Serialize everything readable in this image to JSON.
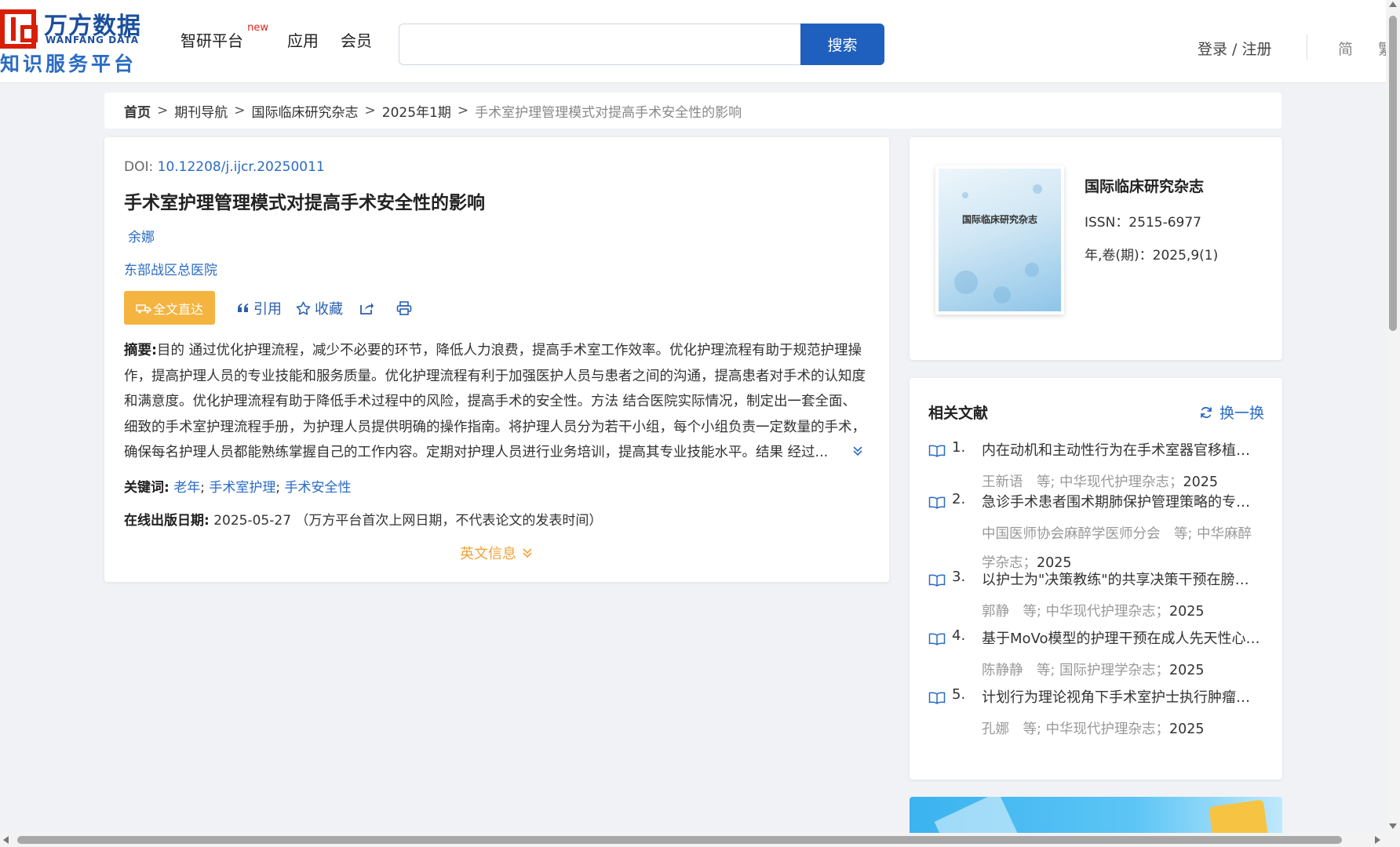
{
  "header": {
    "logo_cn": "万方数据",
    "logo_en": "WANFANG DATA",
    "logo_sub": "知识服务平台",
    "nav": [
      {
        "label": "智研平台",
        "badge": "new"
      },
      {
        "label": "应用"
      },
      {
        "label": "会员"
      }
    ],
    "search_value": "",
    "search_button": "搜索",
    "login": "登录 / 注册",
    "lang_simplified": "简",
    "lang_traditional": "繁"
  },
  "breadcrumb": {
    "items": [
      "首页",
      "期刊导航",
      "国际临床研究杂志",
      "2025年1期"
    ],
    "current": "手术室护理管理模式对提高手术安全性的影响",
    "separator": ">"
  },
  "article": {
    "doi_label": "DOI:",
    "doi_value": "10.12208/j.ijcr.20250011",
    "title": "手术室护理管理模式对提高手术安全性的影响",
    "author": "余娜",
    "organization": "东部战区总医院",
    "actions": {
      "fulltext": "全文直达",
      "cite": "引用",
      "favorite": "收藏"
    },
    "abstract_label": "摘要:",
    "abstract_text": "目的 通过优化护理流程，减少不必要的环节，降低人力浪费，提高手术室工作效率。优化护理流程有助于规范护理操作，提高护理人员的专业技能和服务质量。优化护理流程有利于加强医护人员与患者之间的沟通，提高患者对手术的认知度和满意度。优化护理流程有助于降低手术过程中的风险，提高手术的安全性。方法 结合医院实际情况，制定出一套全面、细致的手术室护理流程手册，为护理人员提供明确的操作指南。将护理人员分为若干小组，每个小组负责一定数量的手术，确保每名护理人员都能熟练掌握自己的工作内容。定期对护理人员进行业务培训，提高其专业技能水平。结果 经过...",
    "keywords_label": "关键词:",
    "keywords": [
      "老年",
      "手术室护理",
      "手术安全性"
    ],
    "pubdate_label": "在线出版日期:",
    "pubdate_value": "2025-05-27",
    "pubdate_note": "（万方平台首次上网日期，不代表论文的发表时间）",
    "english_info": "英文信息"
  },
  "journal": {
    "cover_title": "国际临床研究杂志",
    "name": "国际临床研究杂志",
    "issn": "ISSN：2515-6977",
    "volume": "年,卷(期)：2025,9(1)"
  },
  "related": {
    "title": "相关文献",
    "refresh": "换一换",
    "items": [
      {
        "num": "1.",
        "title": "内在动机和主动性行为在手术室器官移植护理中的作用研究",
        "meta": "王新语　等;  中华现代护理杂志；",
        "year": "2025"
      },
      {
        "num": "2.",
        "title": "急诊手术患者围术期肺保护管理策略的专家共识",
        "meta": "中国医师协会麻醉学医师分会　等;  中华麻醉学杂志；",
        "year": "2025"
      },
      {
        "num": "3.",
        "title": "以护士为\"决策教练\"的共享决策干预在膀胱癌患者中的应用",
        "meta": "郭静　等;  中华现代护理杂志；",
        "year": "2025"
      },
      {
        "num": "4.",
        "title": "基于MoVo模型的护理干预在成人先天性心脏病患者中的应用",
        "meta": "陈静静　等;  国际护理学杂志；",
        "year": "2025"
      },
      {
        "num": "5.",
        "title": "计划行为理论视角下手术室护士执行肿瘤手术隔离技术的质性研究",
        "meta": "孔娜　等;  中华现代护理杂志；",
        "year": "2025"
      }
    ]
  },
  "colors": {
    "brand_blue": "#1f5fbd",
    "link_blue": "#2a6bc4",
    "accent_orange": "#f4b43f",
    "logo_red": "#d81e06"
  }
}
